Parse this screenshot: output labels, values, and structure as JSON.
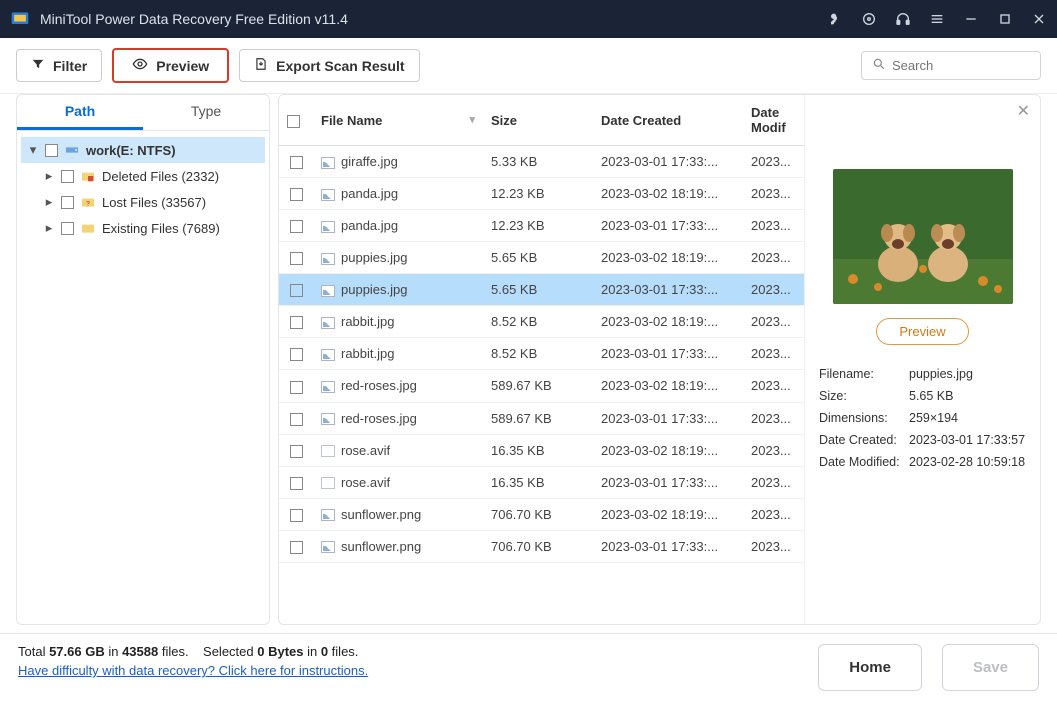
{
  "titlebar": {
    "title": "MiniTool Power Data Recovery Free Edition v11.4"
  },
  "toolbar": {
    "filter_label": "Filter",
    "preview_label": "Preview",
    "export_label": "Export Scan Result",
    "search_placeholder": "Search"
  },
  "sidebar": {
    "tabs": {
      "path": "Path",
      "type": "Type"
    },
    "root": "work(E: NTFS)",
    "items": [
      {
        "label": "Deleted Files (2332)"
      },
      {
        "label": "Lost Files (33567)"
      },
      {
        "label": "Existing Files (7689)"
      }
    ]
  },
  "columns": {
    "name": "File Name",
    "size": "Size",
    "created": "Date Created",
    "modified": "Date Modif"
  },
  "files": [
    {
      "name": "giraffe.jpg",
      "size": "5.33 KB",
      "created": "2023-03-01 17:33:...",
      "modified": "2023...",
      "ico": "img"
    },
    {
      "name": "panda.jpg",
      "size": "12.23 KB",
      "created": "2023-03-02 18:19:...",
      "modified": "2023...",
      "ico": "img"
    },
    {
      "name": "panda.jpg",
      "size": "12.23 KB",
      "created": "2023-03-01 17:33:...",
      "modified": "2023...",
      "ico": "img"
    },
    {
      "name": "puppies.jpg",
      "size": "5.65 KB",
      "created": "2023-03-02 18:19:...",
      "modified": "2023...",
      "ico": "img"
    },
    {
      "name": "puppies.jpg",
      "size": "5.65 KB",
      "created": "2023-03-01 17:33:...",
      "modified": "2023...",
      "ico": "img",
      "selected": true
    },
    {
      "name": "rabbit.jpg",
      "size": "8.52 KB",
      "created": "2023-03-02 18:19:...",
      "modified": "2023...",
      "ico": "img"
    },
    {
      "name": "rabbit.jpg",
      "size": "8.52 KB",
      "created": "2023-03-01 17:33:...",
      "modified": "2023...",
      "ico": "img"
    },
    {
      "name": "red-roses.jpg",
      "size": "589.67 KB",
      "created": "2023-03-02 18:19:...",
      "modified": "2023...",
      "ico": "img"
    },
    {
      "name": "red-roses.jpg",
      "size": "589.67 KB",
      "created": "2023-03-01 17:33:...",
      "modified": "2023...",
      "ico": "img"
    },
    {
      "name": "rose.avif",
      "size": "16.35 KB",
      "created": "2023-03-02 18:19:...",
      "modified": "2023...",
      "ico": "doc"
    },
    {
      "name": "rose.avif",
      "size": "16.35 KB",
      "created": "2023-03-01 17:33:...",
      "modified": "2023...",
      "ico": "doc"
    },
    {
      "name": "sunflower.png",
      "size": "706.70 KB",
      "created": "2023-03-02 18:19:...",
      "modified": "2023...",
      "ico": "img"
    },
    {
      "name": "sunflower.png",
      "size": "706.70 KB",
      "created": "2023-03-01 17:33:...",
      "modified": "2023...",
      "ico": "img"
    }
  ],
  "preview": {
    "button": "Preview",
    "meta": {
      "filename_k": "Filename:",
      "filename_v": "puppies.jpg",
      "size_k": "Size:",
      "size_v": "5.65 KB",
      "dim_k": "Dimensions:",
      "dim_v": "259×194",
      "created_k": "Date Created:",
      "created_v": "2023-03-01 17:33:57",
      "modified_k": "Date Modified:",
      "modified_v": "2023-02-28 10:59:18"
    }
  },
  "footer": {
    "line1_prefix": "Total ",
    "total_size": "57.66 GB",
    "line1_mid": " in ",
    "total_files": "43588",
    "line1_suffix": " files.",
    "selected_text_prefix": "Selected ",
    "selected_bytes": "0 Bytes",
    "selected_mid": " in ",
    "selected_files": "0",
    "selected_suffix": " files.",
    "help_link": "Have difficulty with data recovery? Click here for instructions.",
    "home": "Home",
    "save": "Save"
  }
}
